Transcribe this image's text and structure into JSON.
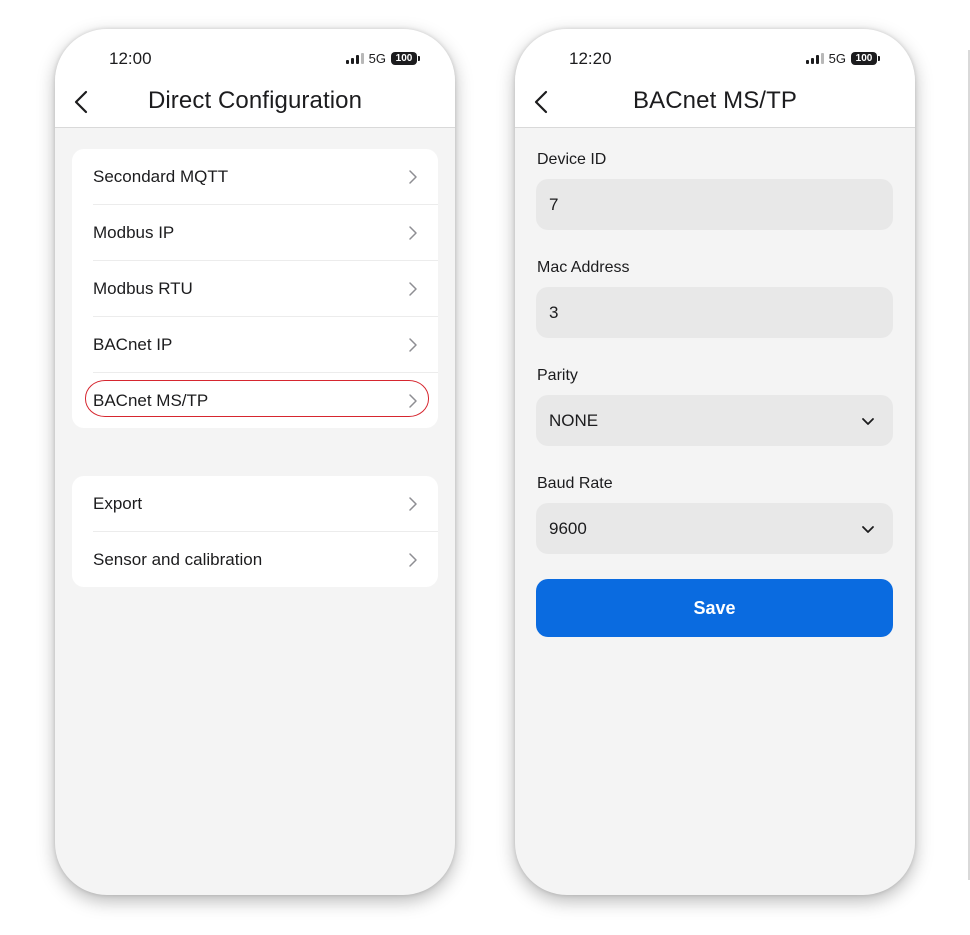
{
  "left_screen": {
    "status_time": "12:00",
    "network": "5G",
    "battery": "100",
    "title": "Direct Configuration",
    "group1": [
      {
        "label": "Secondard MQTT"
      },
      {
        "label": "Modbus IP"
      },
      {
        "label": "Modbus RTU"
      },
      {
        "label": "BACnet IP"
      },
      {
        "label": "BACnet MS/TP",
        "highlighted": true
      }
    ],
    "group2": [
      {
        "label": "Export"
      },
      {
        "label": "Sensor and calibration"
      }
    ],
    "highlight_color": "#d6262f"
  },
  "right_screen": {
    "status_time": "12:20",
    "network": "5G",
    "battery": "100",
    "title": "BACnet MS/TP",
    "device_id": {
      "label": "Device ID",
      "value": "7"
    },
    "mac_address": {
      "label": "Mac Address",
      "value": "3"
    },
    "parity": {
      "label": "Parity",
      "value": "NONE"
    },
    "baud_rate": {
      "label": "Baud Rate",
      "value": "9600"
    },
    "save_label": "Save",
    "accent_color": "#0a6be0"
  },
  "icons": {
    "back": "chevron-left-icon",
    "row": "chevron-right-icon",
    "select": "chevron-down-icon",
    "signal": "signal-bars-icon",
    "battery": "battery-icon"
  }
}
